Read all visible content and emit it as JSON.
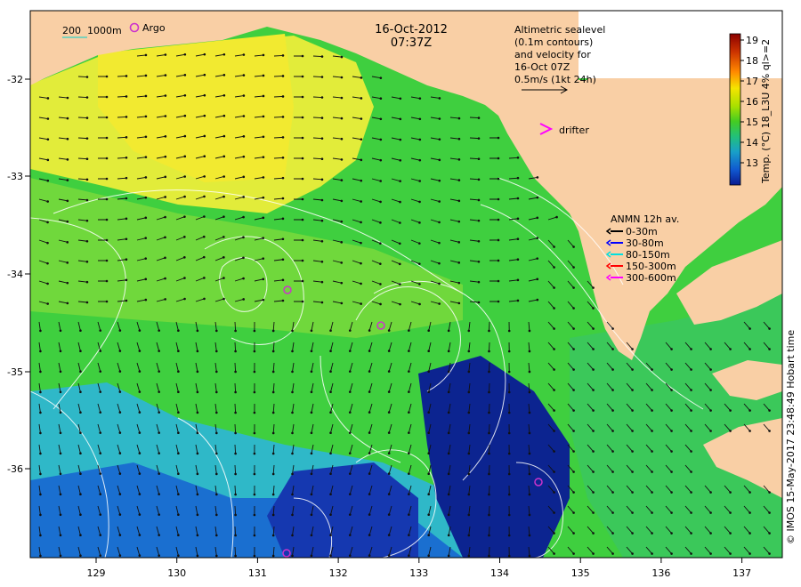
{
  "title": {
    "date": "16-Oct-2012",
    "time": "07:37Z"
  },
  "scale_note": {
    "contour_200": "200",
    "contour_1000": "1000m",
    "argo_label": "Argo"
  },
  "altimetry_note": {
    "line1": "Altimetric sealevel",
    "line2": "(0.1m contours)",
    "line3": "and velocity for",
    "line4": "16-Oct 07Z",
    "line5": "0.5m/s (1kt 24h)"
  },
  "drifter_label": "drifter",
  "anmn_legend": {
    "title": "ANMN 12h av.",
    "items": [
      {
        "label": "0-30m",
        "color": "#000000"
      },
      {
        "label": "30-80m",
        "color": "#0000ff"
      },
      {
        "label": "80-150m",
        "color": "#00e0e0"
      },
      {
        "label": "150-300m",
        "color": "#ff0000"
      },
      {
        "label": "300-600m",
        "color": "#ff00ff"
      }
    ]
  },
  "colorbar": {
    "ticks": [
      "19",
      "18",
      "17",
      "16",
      "15",
      "14",
      "13"
    ],
    "label": "Temp. (°C) 18_L3U 4% ql>=2",
    "colors": [
      "#8b0000",
      "#cc3300",
      "#ff8800",
      "#f5e400",
      "#a8e000",
      "#44cc22",
      "#22c07a",
      "#19a0c8",
      "#1058d0",
      "#0a1a90"
    ]
  },
  "axes": {
    "lat_ticks": [
      "-32",
      "-33",
      "-34",
      "-35",
      "-36"
    ],
    "lon_ticks": [
      "129",
      "130",
      "131",
      "132",
      "133",
      "134",
      "135",
      "136",
      "137"
    ]
  },
  "credit": "© IMOS 15-May-2017 23:48:49 Hobart time",
  "colors": {
    "land": "#f9cfa5",
    "ocean_warm": "#f0ee3a",
    "ocean_mid": "#3fcf3f",
    "ocean_cool": "#22a8d8",
    "ocean_cold": "#0a1f95",
    "contour": "#ffffff",
    "argo": "#cc33cc"
  }
}
